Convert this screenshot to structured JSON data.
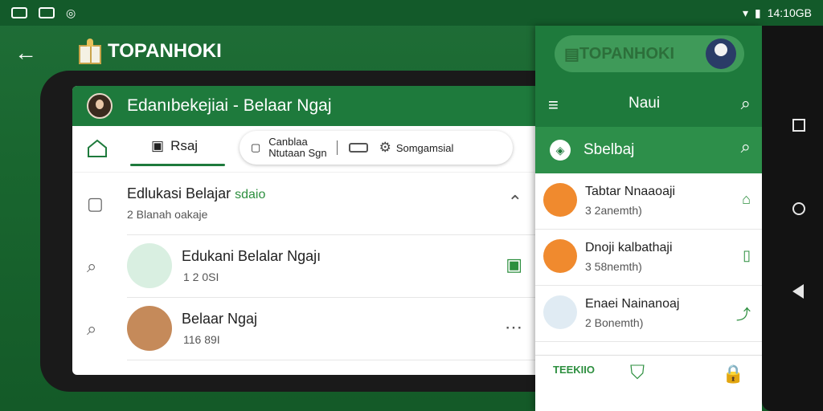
{
  "statusbar": {
    "time": "14:10GB"
  },
  "topbar": {
    "back": "←",
    "brand": "TOPANHOKI"
  },
  "left_screen": {
    "header_title": "Edanıbekejiai - Belaar Ngaj",
    "tab_label": "Rsaj",
    "search": {
      "title": "Canblaa",
      "subtitle": "Ntutaan Sgn",
      "right_label": "Somgamsial"
    },
    "items": [
      {
        "title": "Edlukasi Belajar",
        "tag": "sdaio",
        "subtitle": "2 Blanah oakaje"
      },
      {
        "title": "Edukani Belalar Ngajı",
        "subtitle": "1 2 0SI"
      },
      {
        "title": "Belaar Ngaj",
        "subtitle": "116 89I"
      }
    ]
  },
  "panel": {
    "brand": "TOPANHOKI",
    "nav_title": "Naui",
    "subbar_label": "Sbelbaj",
    "items": [
      {
        "title": "Tabtar Nnaaoaji",
        "subtitle": "3 2anemth)"
      },
      {
        "title": "Dnoji kalbathaji",
        "subtitle": "3 58nemth)"
      },
      {
        "title": "Enaei Nainanoaj",
        "subtitle": "2 Bonemth)"
      }
    ],
    "bottom_logo": "TEEKIIO"
  }
}
